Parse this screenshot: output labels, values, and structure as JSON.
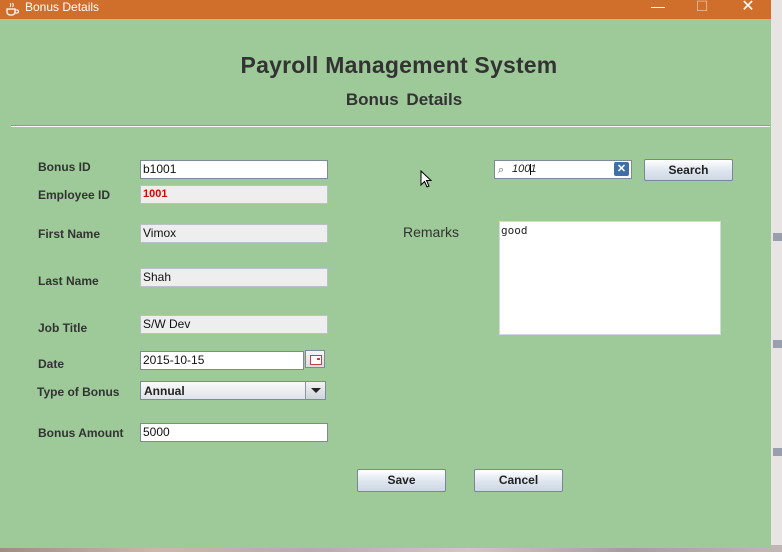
{
  "window": {
    "title": "Bonus Details",
    "icons": {
      "app": "java-coffee-cup-icon",
      "minimize": "minimize-icon",
      "maximize": "maximize-icon",
      "close": "close-icon"
    }
  },
  "header": {
    "title": "Payroll Management System",
    "subtitle": "Bonus  Details"
  },
  "form": {
    "bonus_id": {
      "label": "Bonus  ID",
      "value": "b1001"
    },
    "employee_id": {
      "label": "Employee ID",
      "value": "1001"
    },
    "first_name": {
      "label": "First Name",
      "value": "Vimox"
    },
    "last_name": {
      "label": "Last Name",
      "value": "Shah"
    },
    "job_title": {
      "label": "Job Title",
      "value": "S/W Dev"
    },
    "date": {
      "label": "Date",
      "value": "2015-10-15",
      "picker_icon": "calendar-icon"
    },
    "type_of_bonus": {
      "label": "Type of Bonus",
      "selected": "Annual"
    },
    "bonus_amount": {
      "label": "Bonus Amount",
      "value": "5000"
    },
    "remarks": {
      "label": "Remarks",
      "value": "good"
    }
  },
  "search": {
    "value": "1001",
    "icon": "magnifier-icon",
    "clear_icon": "clear-x-icon",
    "button_label": "Search"
  },
  "actions": {
    "save_label": "Save",
    "cancel_label": "Cancel"
  },
  "colors": {
    "titlebar": "#d06f2c",
    "background": "#9dca98",
    "employee_id_text": "#e00000"
  }
}
